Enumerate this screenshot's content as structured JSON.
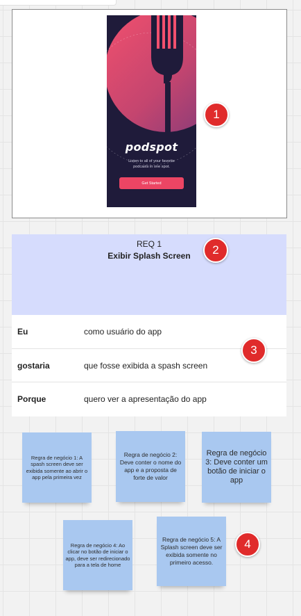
{
  "mockup": {
    "app_logo": "podspot",
    "tagline": "Listen to all of your favorite podcasts in one spot.",
    "cta_label": "Get Started",
    "colors": {
      "background": "#1f1b3a",
      "accent": "#ec4564"
    }
  },
  "badges": [
    "1",
    "2",
    "3",
    "4"
  ],
  "requirement": {
    "number": "REQ 1",
    "title": "Exibir Splash Screen"
  },
  "user_story": [
    {
      "key": "Eu",
      "value": "como usuário do app"
    },
    {
      "key": "gostaria",
      "value": "que fosse exibida a spash screen"
    },
    {
      "key": "Porque",
      "value": "quero ver a apresentação do app"
    }
  ],
  "sticky_notes": [
    "Regra de negócio 1: A spash screen deve ser exibida somente ao abrir o app pela primeira vez",
    "Regra de negócio 2: Deve conter o nome do app e a proposta de forte de valor",
    "Regra de negócio 3: Deve conter um botão de iniciar o app",
    "Regra de negócio 4: Ao clicar no botão de iniciar o app, deve ser redirecionado para a tela de home",
    "Regra de negócio 5: A Splash screen deve ser exibida somente no primeiro acesso."
  ]
}
